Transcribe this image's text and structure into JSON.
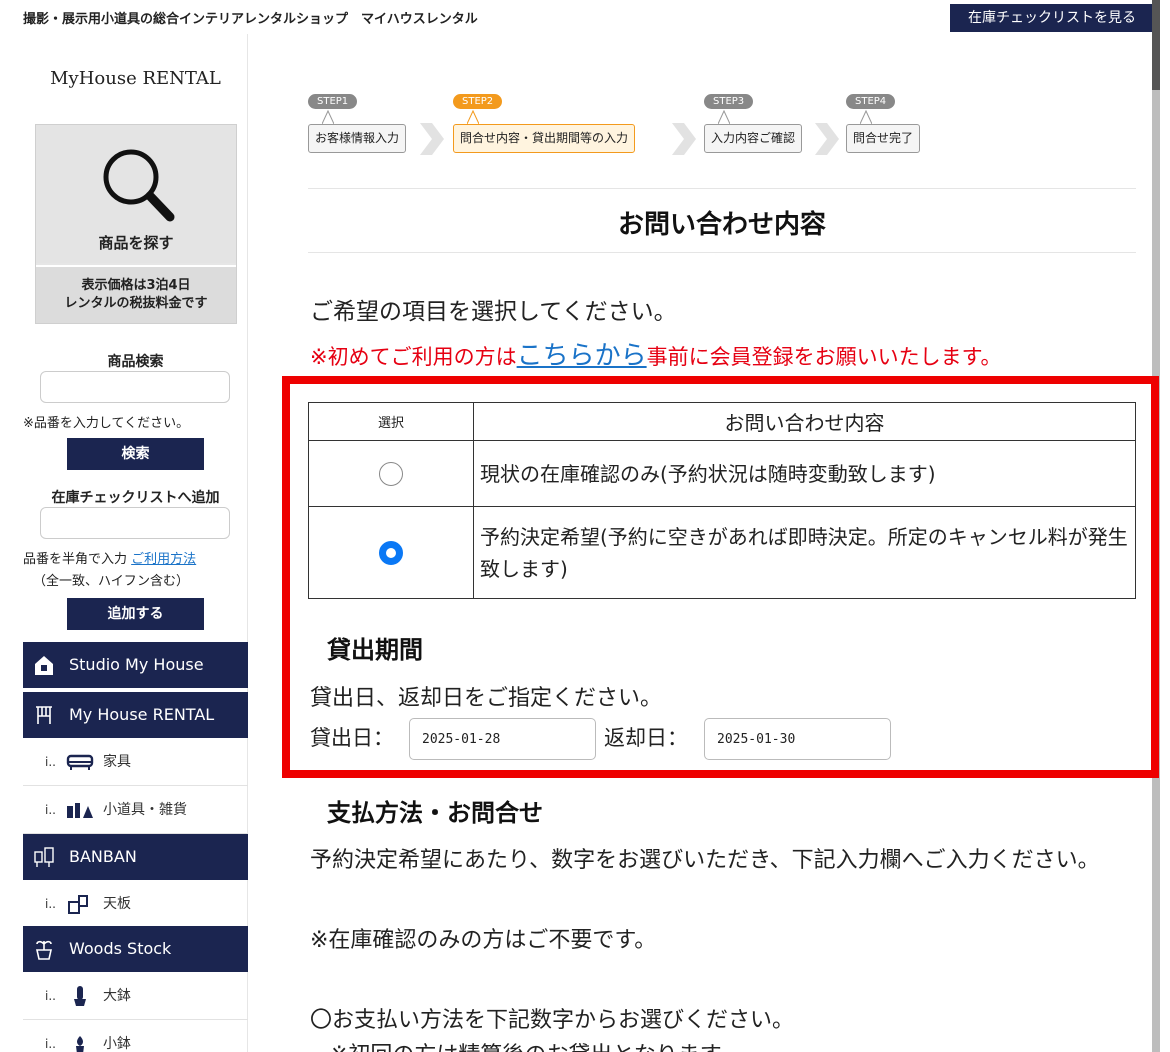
{
  "header": {
    "site_title": "撮影・展示用小道具の総合インテリアレンタルショップ　マイハウスレンタル",
    "checklist_button": "在庫チェックリストを見る"
  },
  "sidebar": {
    "brand": "MyHouse RENTAL",
    "search_box": {
      "label": "商品を探す",
      "note_line1": "表示価格は3泊4日",
      "note_line2": "レンタルの税抜料金です"
    },
    "product_search": {
      "heading": "商品検索",
      "hint": "※品番を入力してください。",
      "button": "検索"
    },
    "add_checklist": {
      "heading": "在庫チェックリストへ追加",
      "hint_prefix": "品番を半角で入力",
      "hint_link": "ご利用方法",
      "hint_line2": "（全一致、ハイフン含む）",
      "button": "追加する"
    },
    "categories": [
      {
        "label": "Studio My House",
        "icon": "house-icon"
      },
      {
        "label": "My House RENTAL",
        "icon": "chair-icon"
      },
      {
        "label": "BANBAN",
        "icon": "banban-icon"
      },
      {
        "label": "Woods Stock",
        "icon": "plant-icon"
      }
    ],
    "subitems": {
      "furniture": "家具",
      "props": "小道具・雑貨",
      "tabletop": "天板",
      "large_pot": "大鉢",
      "small_pot": "小鉢"
    }
  },
  "steps": [
    {
      "tag": "STEP1",
      "label": "お客様情報入力",
      "active": false
    },
    {
      "tag": "STEP2",
      "label": "問合せ内容・貸出期間等の入力",
      "active": true
    },
    {
      "tag": "STEP3",
      "label": "入力内容ご確認",
      "active": false
    },
    {
      "tag": "STEP4",
      "label": "問合せ完了",
      "active": false
    }
  ],
  "main": {
    "section_title": "お問い合わせ内容",
    "lead": "ご希望の項目を選択してください。",
    "notice_prefix": "※初めてご利用の方は",
    "notice_link": "こちらから",
    "notice_suffix": "事前に会員登録をお願いいたします。",
    "table": {
      "col_select": "選択",
      "col_content": "お問い合わせ内容",
      "options": [
        {
          "text": "現状の在庫確認のみ(予約状況は随時変動致します)",
          "selected": false
        },
        {
          "text": "予約決定希望(予約に空きがあれば即時決定。所定のキャンセル料が発生致します)",
          "selected": true
        }
      ]
    },
    "rental_period": {
      "heading": "貸出期間",
      "instruction": "貸出日、返却日をご指定ください。",
      "start_label": "貸出日：",
      "start_value": "2025-01-28",
      "end_label": "返却日：",
      "end_value": "2025-01-30"
    },
    "payment": {
      "heading": "支払方法・お問合せ",
      "text1": "予約決定希望にあたり、数字をお選びいただき、下記入力欄へご入力ください。",
      "text2": "※在庫確認のみの方はご不要です。",
      "text3": "〇お支払い方法を下記数字からお選びください。",
      "text4": "※初回の方は精算後のお貸出となります。"
    }
  }
}
